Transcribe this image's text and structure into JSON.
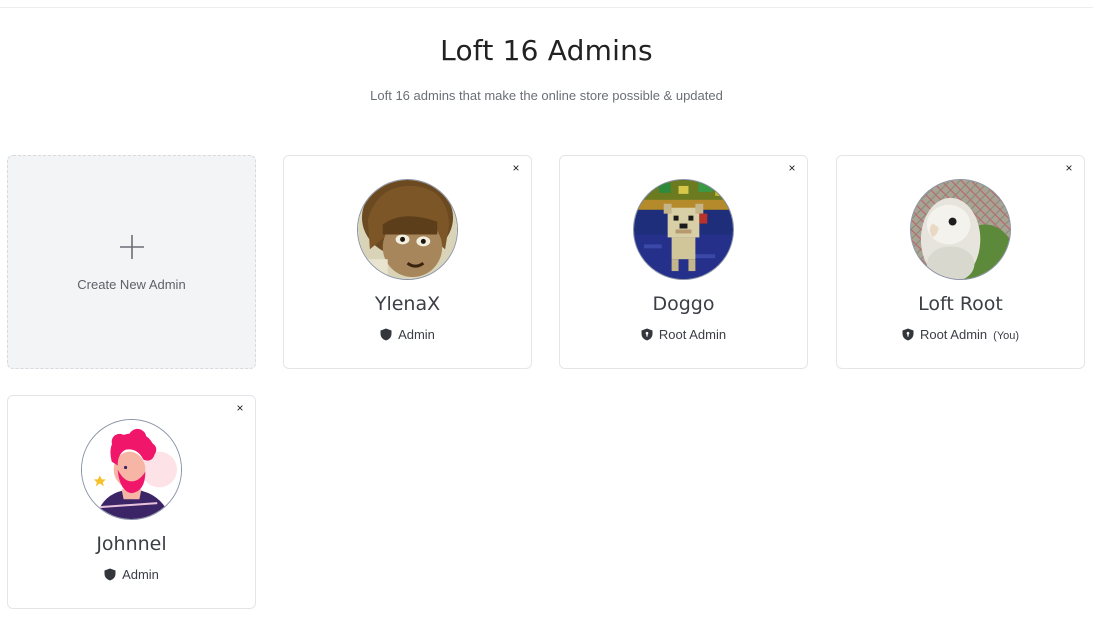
{
  "page": {
    "title": "Loft 16 Admins",
    "subtitle": "Loft 16 admins that make the online store possible & updated"
  },
  "create_card": {
    "label": "Create New Admin",
    "icon": "plus-icon"
  },
  "admins": [
    {
      "name": "YlenaX",
      "role": "Admin",
      "you_label": "",
      "avatar": "anime-character-avatar",
      "remove_icon": "close-icon",
      "role_icon": "shield-icon"
    },
    {
      "name": "Doggo",
      "role": "Root Admin",
      "you_label": "",
      "avatar": "pixel-dog-avatar",
      "remove_icon": "close-icon",
      "role_icon": "shield-keyhole-icon"
    },
    {
      "name": "Loft Root",
      "role": "Root Admin",
      "you_label": "(You)",
      "avatar": "parrot-avatar",
      "remove_icon": "close-icon",
      "role_icon": "shield-keyhole-icon"
    },
    {
      "name": "Johnnel",
      "role": "Admin",
      "you_label": "",
      "avatar": "illustrated-man-avatar",
      "remove_icon": "close-icon",
      "role_icon": "shield-icon"
    }
  ],
  "remove_glyph": "×"
}
